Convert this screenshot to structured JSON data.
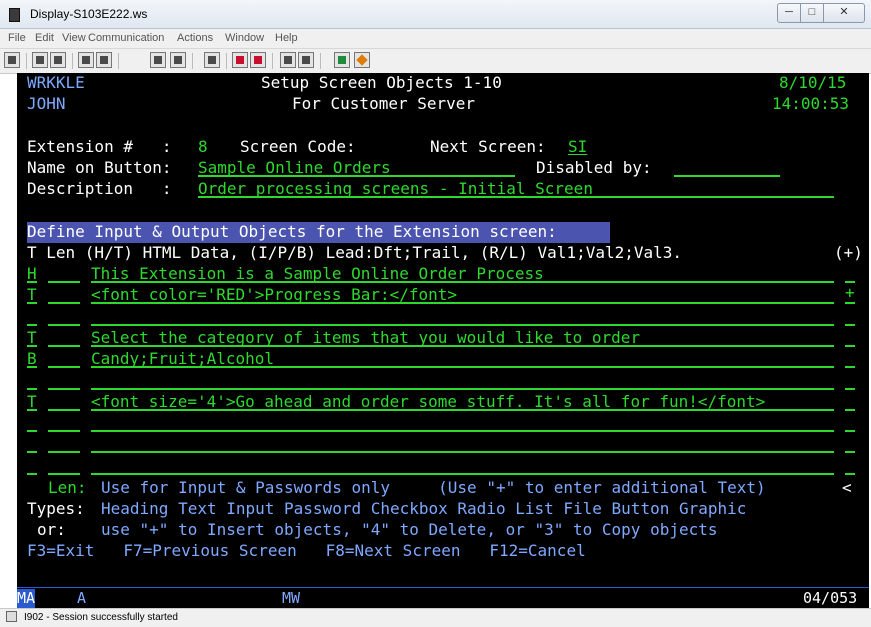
{
  "window": {
    "title": "Display-S103E222.ws",
    "controls": {
      "minimize": "─",
      "maximize": "□",
      "close": "✕"
    }
  },
  "menu": [
    "File",
    "Edit",
    "View",
    "Communication",
    "Actions",
    "Window",
    "Help"
  ],
  "toolbar_icons": [
    "print-screen-icon",
    "copy-icon",
    "paste-icon",
    "send-file-icon",
    "receive-file-icon",
    "display-icon",
    "keypad-icon",
    "macro-icon",
    "record-macro-icon",
    "stop-macro-icon",
    "play-macro-icon",
    "transfer-up-icon",
    "transfer-down-icon",
    "globe-icon",
    "help-icon"
  ],
  "screen": {
    "program": "WRKKLE",
    "title": "Setup Screen Objects 1-10",
    "date": "8/10/15",
    "user": "JOHN",
    "subtitle": "For Customer Server",
    "time": "14:00:53",
    "extension_label": "Extension #   :",
    "extension_value": "8",
    "screen_code_label": "Screen Code:",
    "next_screen_label": "Next Screen:",
    "next_screen_value": "SI",
    "name_label": "Name on Button:",
    "name_value": "Sample Online Orders",
    "disabled_label": "Disabled by:",
    "description_label": "Description   :",
    "description_value": "Order processing screens - Initial Screen",
    "section_heading": "Define Input & Output Objects for the Extension screen:",
    "column_header": "T Len (H/T) HTML Data, (I/P/B) Lead:Dft;Trail, (R/L) Val1;Val2;Val3.",
    "more_indicator": "(+)",
    "rows": [
      {
        "type": "H",
        "data": "This Extension is a Sample Online Order Process",
        "end": ""
      },
      {
        "type": "T",
        "data": "<font color='RED'>Progress Bar:</font>",
        "end": "+"
      },
      {
        "type": "",
        "data": "",
        "end": ""
      },
      {
        "type": "T",
        "data": "Select the category of items that you would like to order",
        "end": ""
      },
      {
        "type": "B",
        "data": "Candy;Fruit;Alcohol",
        "end": ""
      },
      {
        "type": "",
        "data": "",
        "end": ""
      },
      {
        "type": "T",
        "data": "<font size='4'>Go ahead and order some stuff. It's all for fun!</font>",
        "end": ""
      },
      {
        "type": "",
        "data": "",
        "end": ""
      },
      {
        "type": "",
        "data": "",
        "end": ""
      },
      {
        "type": "",
        "data": "",
        "end": ""
      }
    ],
    "help": {
      "len_label": "Len:",
      "len_text": "Use for Input & Passwords only     (Use \"+\" to enter additional Text)",
      "len_marker": "<",
      "types_label": "Types:",
      "types_text": "Heading Text Input Password Checkbox Radio List File Button Graphic",
      "or_label": "or:",
      "or_text": "use \"+\" to Insert objects, \"4\" to Delete, or \"3\" to Copy objects"
    },
    "fkeys": "F3=Exit   F7=Previous Screen   F8=Next Screen   F12=Cancel"
  },
  "oia": {
    "ma": "MA",
    "a": "A",
    "mw": "MW",
    "cursor": "04/053"
  },
  "status": {
    "icon": "session-icon",
    "text": "I902 - Session successfully started"
  },
  "colors": {
    "green": "#2ed92e",
    "white": "#ffffff",
    "blue": "#7fa8ff",
    "highlight": "#4b55b0",
    "background": "#000000"
  }
}
